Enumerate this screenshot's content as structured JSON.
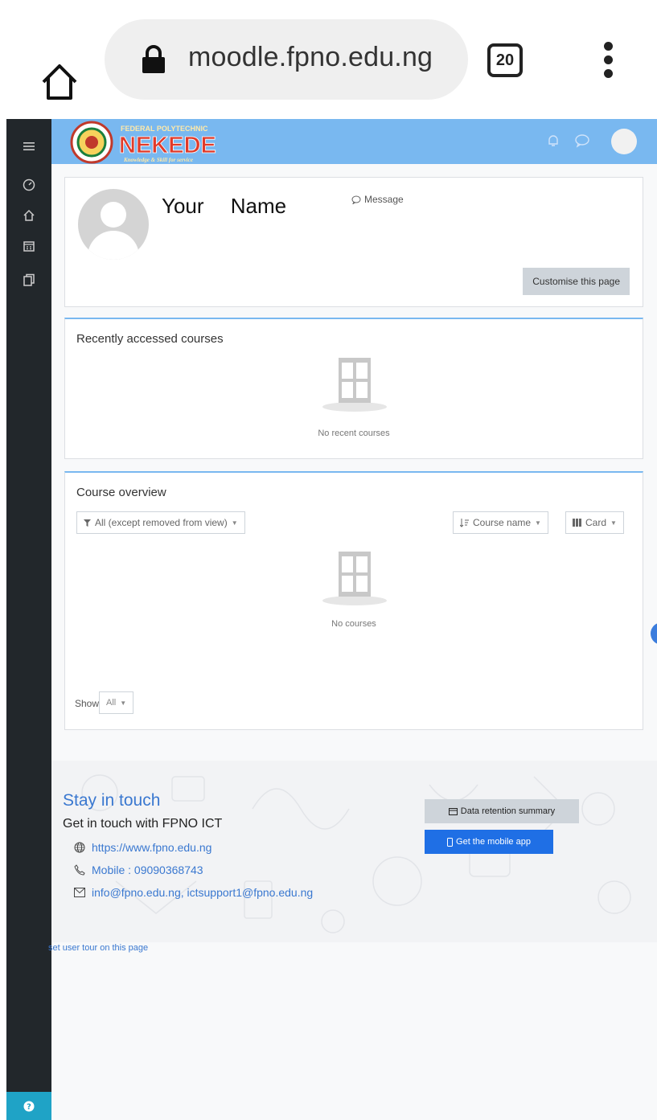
{
  "browser": {
    "url": "moodle.fpno.edu.ng",
    "tab_count": "20"
  },
  "brand": {
    "top_line": "FEDERAL POLYTECHNIC",
    "name": "NEKEDE",
    "tagline": "Knowledge & Skill for service",
    "navbar_color": "#79b8f0"
  },
  "sidebar": {
    "icons": [
      "menu-icon",
      "dashboard-icon",
      "home-icon",
      "calendar-icon",
      "files-icon",
      "help-icon"
    ]
  },
  "profile": {
    "name": "Your Name",
    "message_label": "Message",
    "customise_label": "Customise this page"
  },
  "recent": {
    "title": "Recently accessed courses",
    "empty_text": "No recent courses"
  },
  "overview": {
    "title": "Course overview",
    "filter_label": "All (except removed from view)",
    "sort_label": "Course name",
    "view_label": "Card",
    "empty_text": "No courses",
    "show_label": "Show",
    "show_value": "All"
  },
  "footer": {
    "stay_title": "Stay in touch",
    "get_touch": "Get in touch with FPNO ICT",
    "website": "https://www.fpno.edu.ng",
    "mobile": "Mobile : 09090368743",
    "emails": "info@fpno.edu.ng, ictsupport1@fpno.edu.ng",
    "data_retention": "Data retention summary",
    "mobile_app": "Get the mobile app",
    "reset_tour": "set user tour on this page"
  }
}
